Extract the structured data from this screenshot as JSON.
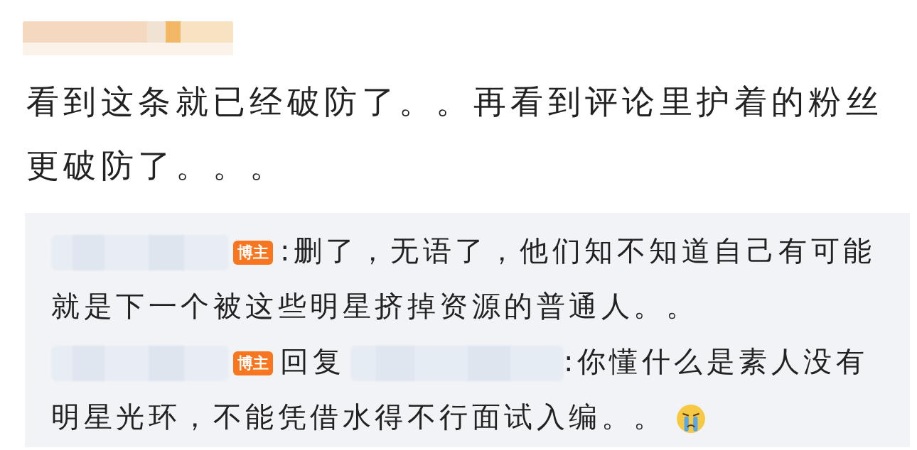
{
  "post": {
    "text": "看到这条就已经破防了。。再看到评论里护着的粉丝更破防了。。。"
  },
  "comments": [
    {
      "badge": "博主",
      "lines": [
        ":删了，无语了，他们知不知道自己有可能",
        "就是下一个被这些明星挤掉资源的普通人。。"
      ],
      "emoji": false
    },
    {
      "badge": "博主",
      "reply_label": "回复",
      "lines": [
        ":你懂什么是素人没有",
        "明星光环，不能凭借水得不行面试入编。。"
      ],
      "emoji": true
    }
  ]
}
